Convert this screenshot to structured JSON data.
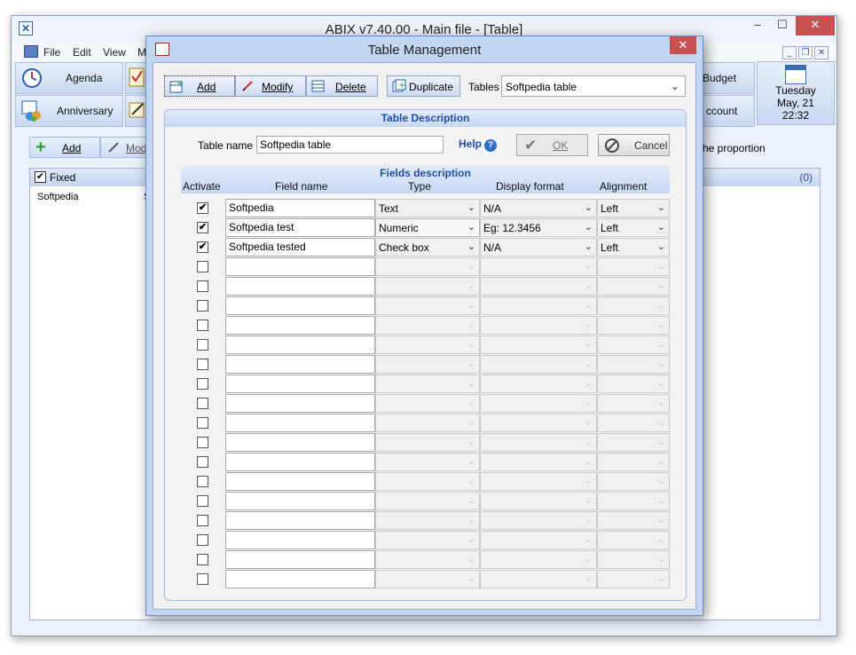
{
  "main_window": {
    "title": "ABIX v7.40.00  -  Main file - [Table]",
    "menu": [
      "File",
      "Edit",
      "View",
      "M"
    ],
    "tiles": [
      {
        "label": "Agenda",
        "icon": "agenda-icon"
      },
      {
        "label": "Anniversary",
        "icon": "anniversary-icon"
      },
      {
        "label": "Budget",
        "icon": "budget-icon"
      },
      {
        "label": "Account",
        "icon": "account-icon"
      }
    ],
    "partial_labels": {
      "budget": "Budget",
      "account": "ccount"
    },
    "clock": {
      "day": "Tuesday",
      "date": "May, 21",
      "time": "22:32"
    },
    "add_label": "Add",
    "modify_label": "Mod",
    "list": {
      "header": "Fixed",
      "count": "(0)",
      "row": "Softpedia",
      "row_extra": "S"
    },
    "proportion_text": "he proportion"
  },
  "dialog": {
    "title": "Table Management",
    "toolbar": {
      "add": "Add",
      "modify": "Modify",
      "delete": "Delete",
      "duplicate": "Duplicate",
      "tables_label": "Tables",
      "tables_value": "Softpedia table"
    },
    "section_title": "Table Description",
    "table_name_label": "Table name",
    "table_name_value": "Softpedia table",
    "help": "Help",
    "ok": "OK",
    "cancel": "Cancel",
    "fields_title": "Fields description",
    "columns": {
      "activate": "Activate",
      "field_name": "Field name",
      "type": "Type",
      "display_format": "Display format",
      "alignment": "Alignment"
    },
    "rows": [
      {
        "checked": true,
        "name": "Softpedia",
        "type": "Text",
        "format": "N/A",
        "align": "Left"
      },
      {
        "checked": true,
        "name": "Softpedia test",
        "type": "Numeric",
        "format": "Eg: 12.3456",
        "align": "Left"
      },
      {
        "checked": true,
        "name": "Softpedia tested",
        "type": "Check box",
        "format": "N/A",
        "align": "Left"
      }
    ],
    "empty_rows": 17
  }
}
